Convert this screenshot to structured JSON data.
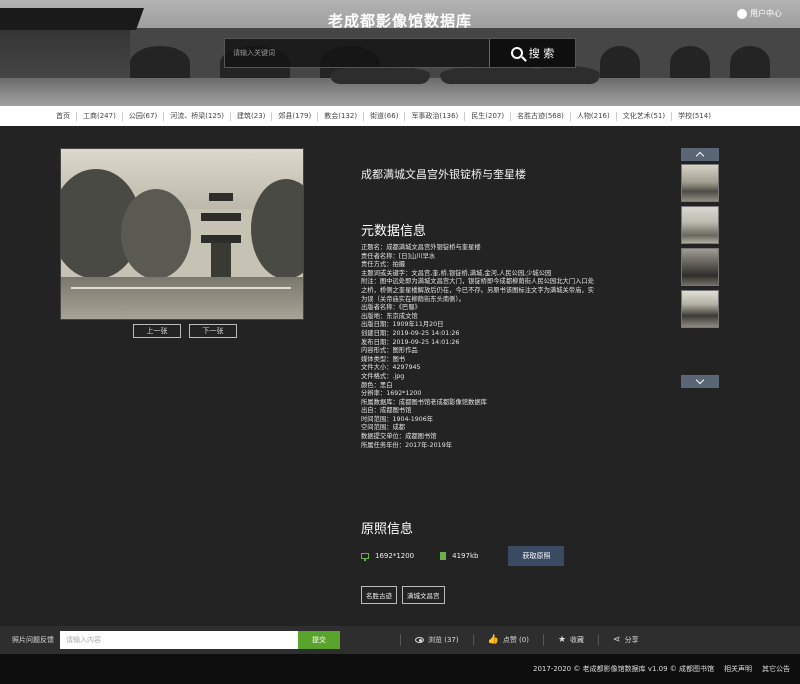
{
  "header": {
    "site_title": "老成都影像馆数据库",
    "user_center": "用户中心",
    "search_placeholder": "请输入关键词",
    "search_button": "搜 索"
  },
  "categories": [
    "首页",
    "工商(247)",
    "公园(67)",
    "河流、桥梁(125)",
    "建筑(23)",
    "郊县(179)",
    "教会(132)",
    "街道(66)",
    "军事政治(136)",
    "民生(207)",
    "名胜古迹(568)",
    "人物(216)",
    "文化艺术(51)",
    "学校(514)"
  ],
  "photo": {
    "prev_label": "上一张",
    "next_label": "下一张"
  },
  "detail": {
    "title": "成都满城文昌宫外银锭桥与奎星楼",
    "metadata_heading": "元数据信息",
    "metadata": [
      "正题名：成都满城文昌宫外银锭桥与奎星楼",
      "责任者名称：[日]山川早水",
      "责任方式：拍摄",
      "主题词或关键字：文昌宫,奎,桥,银锭桥,满城,金河,人民公园,少城公园",
      "附注：图中远处即为满城文昌宫大门，银锭桥即今成都柳荫街人民公园北大门入口处",
      "之桥，桥侧之奎星楼解放后仍在，今已不存。另原书该图标注文字为满城关帝庙，实",
      "为误（关帝庙实在柳荫街东头南侧）。",
      "出版者名称：《巴蜀》",
      "出版地：东京成文馆",
      "出版日期：1909年11月20日",
      "创建日期：2019-09-25 14:01:26",
      "发布日期：2019-09-25 14:01:26",
      "内容形式：图形作品",
      "媒体类型：图书",
      "文件大小：4297945",
      "文件格式：.jpg",
      "颜色：黑白",
      "分辨率：1692*1200",
      "所属数据库：成都图书馆老成都影像馆数据库",
      "出自：成都图书馆",
      "时间范围：1904-1906年",
      "空间范围：成都",
      "数据提交单位：成都图书馆",
      "所属任务年份：2017年-2019年"
    ],
    "original_heading": "原照信息",
    "resolution": "1692*1200",
    "filesize": "4197kb",
    "get_original": "获取原照",
    "tags": [
      "名胜古迹",
      "满城文昌宫"
    ]
  },
  "actionbar": {
    "feedback_label": "照片问题反馈",
    "feedback_placeholder": "请输入内容",
    "submit": "提交",
    "views": "浏览 (37)",
    "likes": "点赞 (0)",
    "favorite": "收藏",
    "share": "分享"
  },
  "footer": {
    "copyright": "2017-2020 © 老成都影像馆数据库 v1.09 © 成都图书馆",
    "disclaimer": "相关声明",
    "notice": "其它公告"
  },
  "colors": {
    "accent_green": "#5aa32d",
    "button_navy": "#3a4a62",
    "background": "#232323"
  }
}
